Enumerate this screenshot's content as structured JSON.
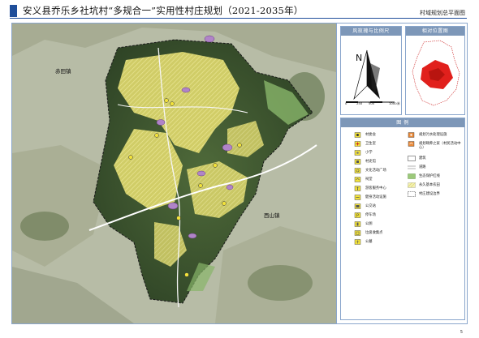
{
  "header": {
    "title": "安义县乔乐乡社坑村“多规合一”实用性村庄规划（2021-2035年）",
    "subtitle": "村域规划总平面图"
  },
  "map": {
    "town_labels": [
      "赤田镇",
      "西山镇"
    ]
  },
  "compass_panel": {
    "title": "风玫瑰与比例尺",
    "north_label": "N",
    "scale_ticks": [
      "0",
      "250",
      "500",
      "1000"
    ],
    "scale_unit": "米"
  },
  "location_panel": {
    "title": "相对位置图"
  },
  "legend": {
    "title": "图  例",
    "items_left": [
      {
        "label": "村委会",
        "icon": "village-committee-icon"
      },
      {
        "label": "卫生室",
        "icon": "clinic-icon"
      },
      {
        "label": "小学",
        "icon": "school-icon"
      },
      {
        "label": "村史馆",
        "icon": "history-hall-icon"
      },
      {
        "label": "文化活动广场",
        "icon": "culture-square-icon"
      },
      {
        "label": "祠堂",
        "icon": "ancestral-hall-icon"
      },
      {
        "label": "游客服务中心",
        "icon": "visitor-center-icon"
      },
      {
        "label": "健身活动设施",
        "icon": "fitness-icon"
      },
      {
        "label": "公交站",
        "icon": "bus-stop-icon"
      },
      {
        "label": "停车场",
        "icon": "parking-icon"
      },
      {
        "label": "公厕",
        "icon": "toilet-icon"
      },
      {
        "label": "垃圾收集点",
        "icon": "garbage-point-icon"
      },
      {
        "label": "公墓",
        "icon": "cemetery-icon"
      }
    ],
    "items_right": [
      {
        "label": "规划污水处理设施",
        "icon": "sewage-icon"
      },
      {
        "label": "规划颐养之家（村民活动中心）",
        "icon": "elderly-home-icon"
      },
      {
        "label": "建筑",
        "icon": "building-swatch"
      },
      {
        "label": "道路",
        "icon": "road-swatch"
      },
      {
        "label": "生态保护红线",
        "icon": "eco-redline-swatch"
      },
      {
        "label": "永久基本农田",
        "icon": "farmland-swatch"
      },
      {
        "label": "村庄建设边界",
        "icon": "boundary-swatch"
      }
    ]
  },
  "colors": {
    "accent": "#1f4e9a",
    "panel_header": "#7d97b8",
    "farmland": "#e9e27a",
    "eco_redline": "#9cc97a",
    "location_highlight": "#e1201c"
  },
  "page_number": "5"
}
